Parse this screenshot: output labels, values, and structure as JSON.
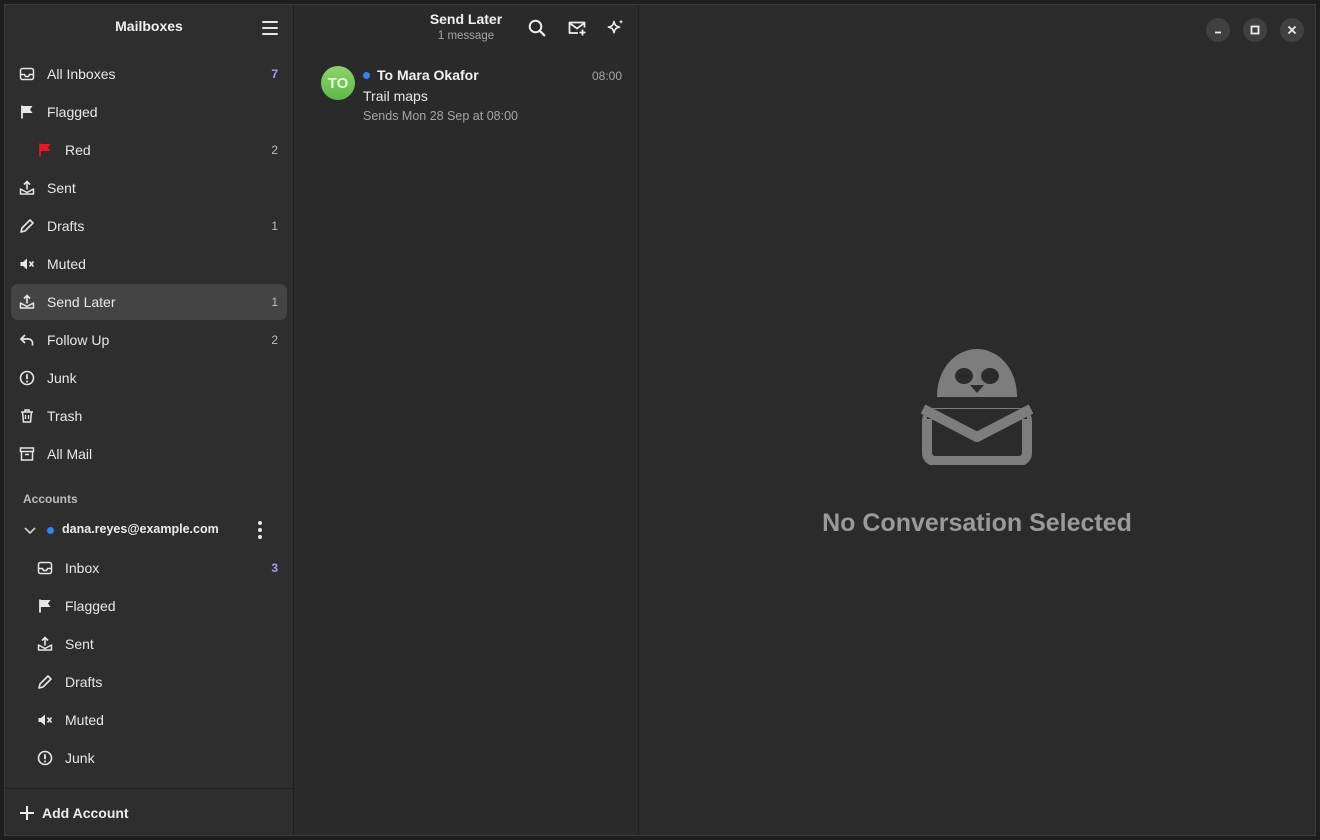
{
  "sidebar": {
    "title": "Mailboxes",
    "items": [
      {
        "label": "All Inboxes",
        "count": "7",
        "icon": "inbox-icon"
      },
      {
        "label": "Flagged",
        "count": "",
        "icon": "flag-icon"
      },
      {
        "label": "Red",
        "count": "2",
        "icon": "red-flag-icon"
      },
      {
        "label": "Sent",
        "count": "",
        "icon": "sent-icon"
      },
      {
        "label": "Drafts",
        "count": "1",
        "icon": "pencil-icon"
      },
      {
        "label": "Muted",
        "count": "",
        "icon": "muted-icon"
      },
      {
        "label": "Send Later",
        "count": "1",
        "icon": "send-later-icon"
      },
      {
        "label": "Follow Up",
        "count": "2",
        "icon": "reply-icon"
      },
      {
        "label": "Junk",
        "count": "",
        "icon": "junk-icon"
      },
      {
        "label": "Trash",
        "count": "",
        "icon": "trash-icon"
      },
      {
        "label": "All Mail",
        "count": "",
        "icon": "archive-icon"
      }
    ],
    "accounts_heading": "Accounts",
    "account": {
      "email": "dana.reyes@example.com",
      "folders": [
        {
          "label": "Inbox",
          "count": "3",
          "icon": "inbox-icon"
        },
        {
          "label": "Flagged",
          "count": "",
          "icon": "flag-icon"
        },
        {
          "label": "Sent",
          "count": "",
          "icon": "sent-icon"
        },
        {
          "label": "Drafts",
          "count": "",
          "icon": "pencil-icon"
        },
        {
          "label": "Muted",
          "count": "",
          "icon": "muted-icon"
        },
        {
          "label": "Junk",
          "count": "",
          "icon": "junk-icon"
        }
      ]
    },
    "add_account": "Add Account"
  },
  "message_list": {
    "title": "Send Later",
    "subtitle": "1 message",
    "messages": [
      {
        "initials": "TO",
        "from": "To Mara Okafor",
        "time": "08:00",
        "subject": "Trail maps",
        "schedule": "Sends Mon 28 Sep at 08:00"
      }
    ]
  },
  "reading_pane": {
    "empty_text": "No Conversation Selected"
  },
  "colors": {
    "accent_count": "#a59bf0",
    "unread_dot": "#3584e4",
    "red_flag": "#e01b24",
    "avatar": "#6cc24a"
  }
}
